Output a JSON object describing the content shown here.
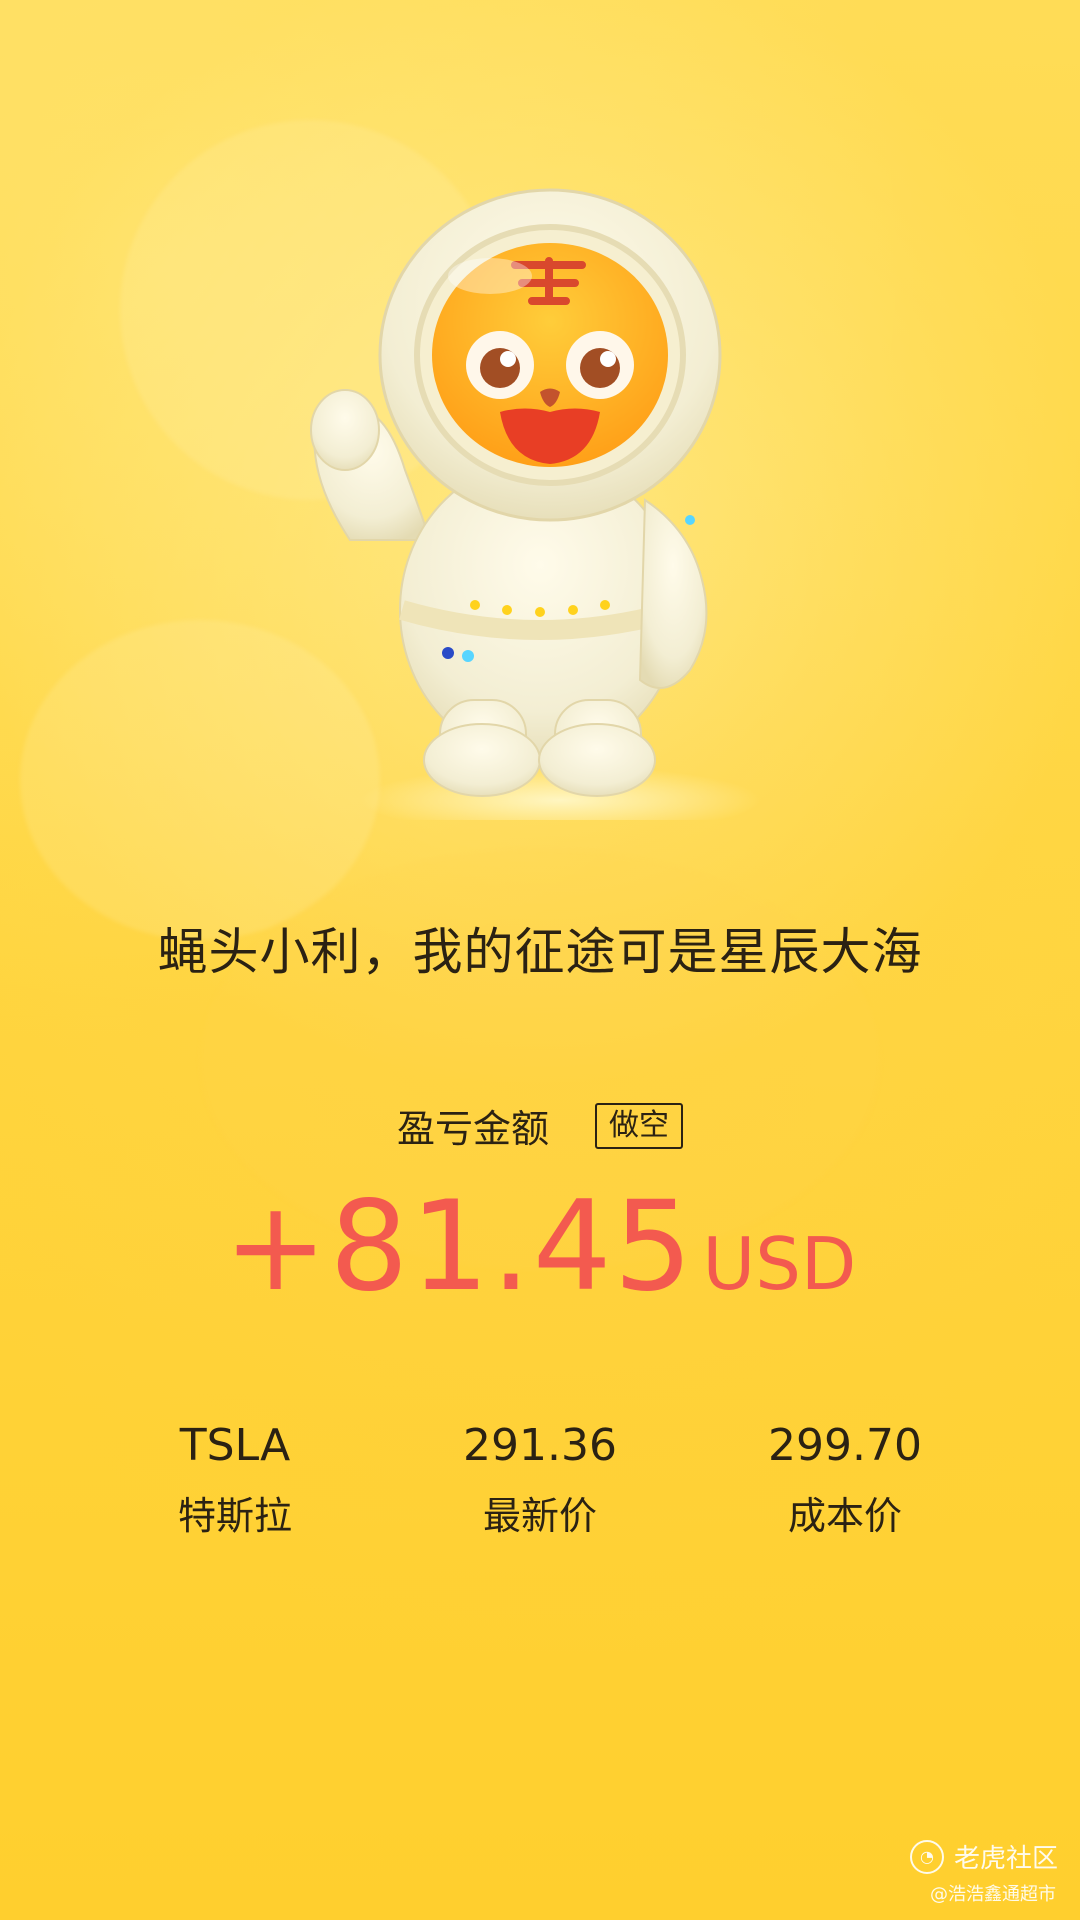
{
  "slogan": "蝇头小利，我的征途可是星辰大海",
  "pnl": {
    "label": "盈亏金额",
    "position_type": "做空",
    "amount": "+81.45",
    "currency": "USD"
  },
  "stats": [
    {
      "top": "TSLA",
      "bottom": "特斯拉"
    },
    {
      "top": "291.36",
      "bottom": "最新价"
    },
    {
      "top": "299.70",
      "bottom": "成本价"
    }
  ],
  "watermark": {
    "brand": "老虎社区",
    "handle": "@浩浩鑫通超市"
  },
  "colors": {
    "background": "#ffd53f",
    "accent_red": "#f35a4f",
    "text_dark": "#2b2213",
    "mascot_face": "#ffb31d"
  }
}
